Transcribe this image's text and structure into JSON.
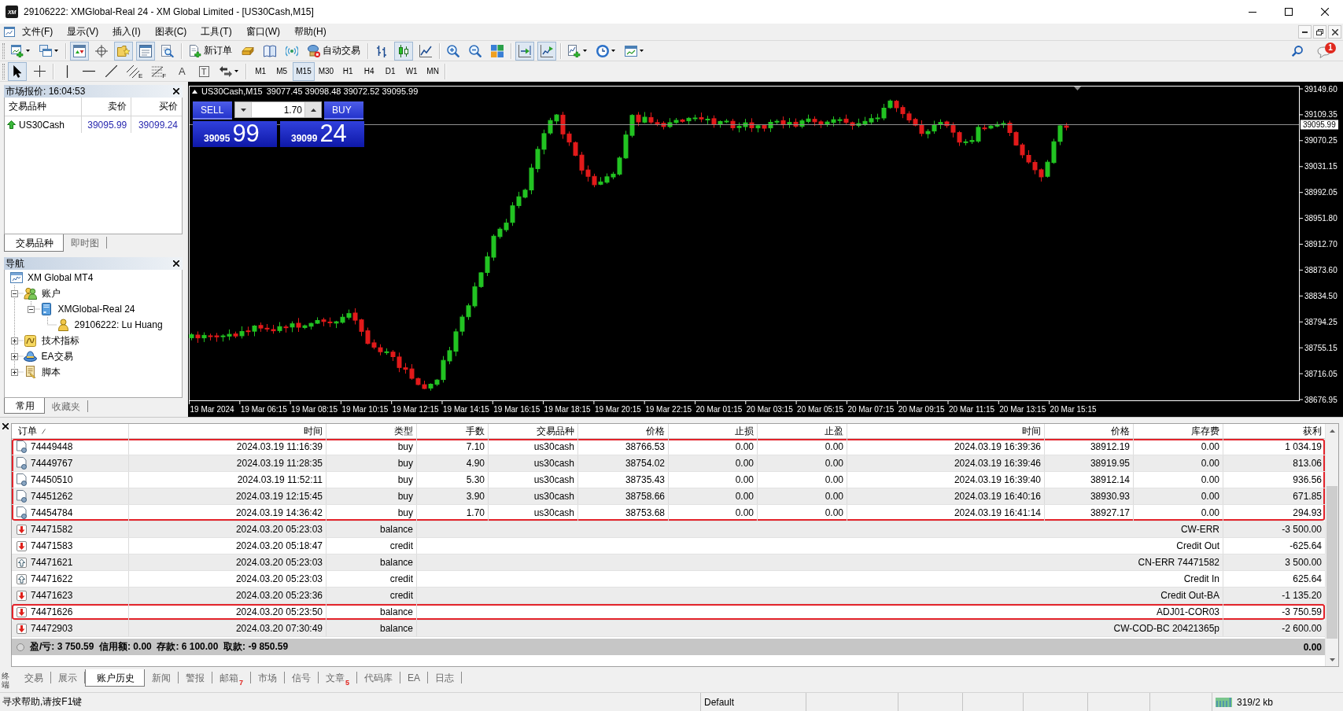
{
  "window": {
    "logo": "XM",
    "title": "29106222: XMGlobal-Real 24 - XM Global Limited - [US30Cash,M15]"
  },
  "menu": [
    "文件(F)",
    "显示(V)",
    "插入(I)",
    "图表(C)",
    "工具(T)",
    "窗口(W)",
    "帮助(H)"
  ],
  "toolbar": {
    "buttons": [
      {
        "kind": "icon",
        "pressed": false,
        "dropdown": true
      },
      {
        "kind": "icon",
        "pressed": false,
        "dropdown": true
      },
      {
        "kind": "separator"
      },
      {
        "kind": "icon",
        "pressed": true
      },
      {
        "kind": "icon",
        "pressed": false
      },
      {
        "kind": "icon",
        "pressed": true
      },
      {
        "kind": "icon",
        "pressed": true
      },
      {
        "kind": "icon",
        "pressed": false
      },
      {
        "kind": "separator"
      },
      {
        "kind": "labeled",
        "label": "新订单",
        "pressed": false
      },
      {
        "kind": "icon",
        "pressed": false
      },
      {
        "kind": "icon",
        "pressed": false
      },
      {
        "kind": "icon",
        "pressed": false
      },
      {
        "kind": "labeled",
        "label": "自动交易",
        "pressed": false
      },
      {
        "kind": "separator"
      },
      {
        "kind": "icon",
        "pressed": false
      },
      {
        "kind": "icon",
        "pressed": true
      },
      {
        "kind": "icon",
        "pressed": false
      },
      {
        "kind": "separator"
      },
      {
        "kind": "icon",
        "pressed": false
      },
      {
        "kind": "icon",
        "pressed": false
      },
      {
        "kind": "icon",
        "pressed": false
      },
      {
        "kind": "separator"
      },
      {
        "kind": "icon",
        "pressed": true
      },
      {
        "kind": "icon",
        "pressed": true
      },
      {
        "kind": "separator"
      },
      {
        "kind": "icon",
        "pressed": false,
        "dropdown": true
      },
      {
        "kind": "icon",
        "pressed": false,
        "dropdown": true
      },
      {
        "kind": "icon",
        "pressed": false,
        "dropdown": true
      }
    ],
    "notification_count": "1"
  },
  "drawing_toolbar": {
    "tools": [
      {
        "kind": "icon",
        "pressed": true
      },
      {
        "kind": "icon",
        "pressed": false
      },
      {
        "kind": "separator"
      },
      {
        "kind": "icon",
        "pressed": false
      },
      {
        "kind": "icon",
        "pressed": false
      },
      {
        "kind": "icon",
        "pressed": false
      },
      {
        "kind": "icon",
        "pressed": false,
        "subscript": "E"
      },
      {
        "kind": "icon",
        "pressed": false,
        "subscript": "F"
      },
      {
        "kind": "glyph",
        "text": "A",
        "pressed": false
      },
      {
        "kind": "glyph",
        "text": "T",
        "boxed": true,
        "pressed": false
      },
      {
        "kind": "icon",
        "pressed": false,
        "dropdown": true
      },
      {
        "kind": "separator"
      }
    ],
    "timeframes": [
      {
        "label": "M1",
        "selected": false
      },
      {
        "label": "M5",
        "selected": false
      },
      {
        "label": "M15",
        "selected": true
      },
      {
        "label": "M30",
        "selected": false
      },
      {
        "label": "H1",
        "selected": false
      },
      {
        "label": "H4",
        "selected": false
      },
      {
        "label": "D1",
        "selected": false
      },
      {
        "label": "W1",
        "selected": false
      },
      {
        "label": "MN",
        "selected": false
      }
    ]
  },
  "market_watch": {
    "title": "市场报价: 16:04:53",
    "columns": [
      "交易品种",
      "卖价",
      "买价"
    ],
    "rows": [
      {
        "kind": "rising",
        "symbol": "US30Cash",
        "bid": "39095.99",
        "ask": "39099.24"
      }
    ],
    "tabs": [
      {
        "label": "交易品种",
        "selected": true
      },
      {
        "label": "即时图",
        "selected": false
      }
    ]
  },
  "navigator": {
    "title": "导航",
    "tree": [
      {
        "kind": "terminal",
        "label": "XM Global MT4",
        "children": [
          {
            "kind": "accounts",
            "label": "账户",
            "expanded": true,
            "children": [
              {
                "kind": "server",
                "label": "XMGlobal-Real 24",
                "expanded": true,
                "children": [
                  {
                    "kind": "account",
                    "label": "29106222: Lu Huang"
                  }
                ]
              }
            ]
          },
          {
            "kind": "indicators",
            "label": "技术指标",
            "expanded": false
          },
          {
            "kind": "experts",
            "label": "EA交易",
            "expanded": false
          },
          {
            "kind": "scripts",
            "label": "脚本",
            "expanded": false
          }
        ]
      }
    ],
    "tabs": [
      {
        "label": "常用",
        "selected": true
      },
      {
        "label": "收藏夹",
        "selected": false
      }
    ]
  },
  "chart": {
    "symbol": "US30Cash,M15",
    "ohlc": "39077.45 39098.48 39072.52 39095.99",
    "trade_panel": {
      "sell": "SELL",
      "buy": "BUY",
      "volume": "1.70",
      "bid_main": "39095",
      "bid_big": "99",
      "ask_main": "39099",
      "ask_big": "24"
    },
    "price_labels": [
      "39149.60",
      "39109.35",
      "39070.25",
      "39031.15",
      "38992.05",
      "38951.80",
      "38912.70",
      "38873.60",
      "38834.50",
      "38794.25",
      "38755.15",
      "38716.05",
      "38676.95"
    ],
    "current_price": "39095.99",
    "time_labels": [
      "19 Mar 2024",
      "19 Mar 06:15",
      "19 Mar 08:15",
      "19 Mar 10:15",
      "19 Mar 12:15",
      "19 Mar 14:15",
      "19 Mar 16:15",
      "19 Mar 18:15",
      "19 Mar 20:15",
      "19 Mar 22:15",
      "20 Mar 01:15",
      "20 Mar 03:15",
      "20 Mar 05:15",
      "20 Mar 07:15",
      "20 Mar 09:15",
      "20 Mar 11:15",
      "20 Mar 13:15",
      "20 Mar 15:15"
    ]
  },
  "terminal": {
    "label": "终端",
    "columns": [
      {
        "label": "订单",
        "sorted": true
      },
      {
        "label": "时间",
        "sorted": false
      },
      {
        "label": "类型",
        "sorted": false
      },
      {
        "label": "手数",
        "sorted": false
      },
      {
        "label": "交易品种",
        "sorted": false
      },
      {
        "label": "价格",
        "sorted": false
      },
      {
        "label": "止损",
        "sorted": false
      },
      {
        "label": "止盈",
        "sorted": false
      },
      {
        "label": "时间",
        "sorted": false
      },
      {
        "label": "价格",
        "sorted": false
      },
      {
        "label": "库存费",
        "sorted": false
      },
      {
        "label": "获利",
        "sorted": false
      }
    ],
    "rows": [
      {
        "kind": "trade",
        "highlighted": true,
        "cells": [
          "74449448",
          "2024.03.19 11:16:39",
          "buy",
          "7.10",
          "us30cash",
          "38766.53",
          "0.00",
          "0.00",
          "2024.03.19 16:39:36",
          "38912.19",
          "0.00",
          "1 034.19"
        ]
      },
      {
        "kind": "trade",
        "highlighted": true,
        "cells": [
          "74449767",
          "2024.03.19 11:28:35",
          "buy",
          "4.90",
          "us30cash",
          "38754.02",
          "0.00",
          "0.00",
          "2024.03.19 16:39:46",
          "38919.95",
          "0.00",
          "813.06"
        ]
      },
      {
        "kind": "trade",
        "highlighted": true,
        "cells": [
          "74450510",
          "2024.03.19 11:52:11",
          "buy",
          "5.30",
          "us30cash",
          "38735.43",
          "0.00",
          "0.00",
          "2024.03.19 16:39:40",
          "38912.14",
          "0.00",
          "936.56"
        ]
      },
      {
        "kind": "trade",
        "highlighted": true,
        "cells": [
          "74451262",
          "2024.03.19 12:15:45",
          "buy",
          "3.90",
          "us30cash",
          "38758.66",
          "0.00",
          "0.00",
          "2024.03.19 16:40:16",
          "38930.93",
          "0.00",
          "671.85"
        ]
      },
      {
        "kind": "trade",
        "highlighted": true,
        "cells": [
          "74454784",
          "2024.03.19 14:36:42",
          "buy",
          "1.70",
          "us30cash",
          "38753.68",
          "0.00",
          "0.00",
          "2024.03.19 16:41:14",
          "38927.17",
          "0.00",
          "294.93"
        ]
      },
      {
        "kind": "withdrawal",
        "highlighted": false,
        "cells": [
          "74471582",
          "2024.03.20 05:23:03",
          "balance",
          "CW-ERR",
          "-3 500.00"
        ]
      },
      {
        "kind": "withdrawal",
        "highlighted": false,
        "cells": [
          "74471583",
          "2024.03.20 05:18:47",
          "credit",
          "Credit Out",
          "-625.64"
        ]
      },
      {
        "kind": "deposit",
        "highlighted": false,
        "cells": [
          "74471621",
          "2024.03.20 05:23:03",
          "balance",
          "CN-ERR 74471582",
          "3 500.00"
        ]
      },
      {
        "kind": "deposit",
        "highlighted": false,
        "cells": [
          "74471622",
          "2024.03.20 05:23:03",
          "credit",
          "Credit In",
          "625.64"
        ]
      },
      {
        "kind": "withdrawal",
        "highlighted": false,
        "cells": [
          "74471623",
          "2024.03.20 05:23:36",
          "credit",
          "Credit Out-BA",
          "-1 135.20"
        ]
      },
      {
        "kind": "withdrawal",
        "highlighted": true,
        "cells": [
          "74471626",
          "2024.03.20 05:23:50",
          "balance",
          "ADJ01-COR03",
          "-3 750.59"
        ]
      },
      {
        "kind": "withdrawal",
        "highlighted": false,
        "cells": [
          "74472903",
          "2024.03.20 07:30:49",
          "balance",
          "CW-COD-BC 20421365p",
          "-2 600.00"
        ]
      }
    ],
    "summary": {
      "text": "盈/亏: 3 750.59  信用额: 0.00  存款: 6 100.00  取款: -9 850.59",
      "total": "0.00"
    },
    "tabs": [
      {
        "label": "交易",
        "selected": false
      },
      {
        "label": "展示",
        "selected": false
      },
      {
        "label": "账户历史",
        "selected": true
      },
      {
        "label": "新闻",
        "selected": false
      },
      {
        "label": "警报",
        "selected": false
      },
      {
        "label": "邮箱",
        "badge": "7",
        "selected": false
      },
      {
        "label": "市场",
        "selected": false
      },
      {
        "label": "信号",
        "selected": false
      },
      {
        "label": "文章",
        "badge": "5",
        "selected": false
      },
      {
        "label": "代码库",
        "selected": false
      },
      {
        "label": "EA",
        "selected": false
      },
      {
        "label": "日志",
        "selected": false
      }
    ]
  },
  "status_bar": {
    "help": "寻求帮助,请按F1键",
    "profile": "Default",
    "traffic": "319/2 kb"
  }
}
